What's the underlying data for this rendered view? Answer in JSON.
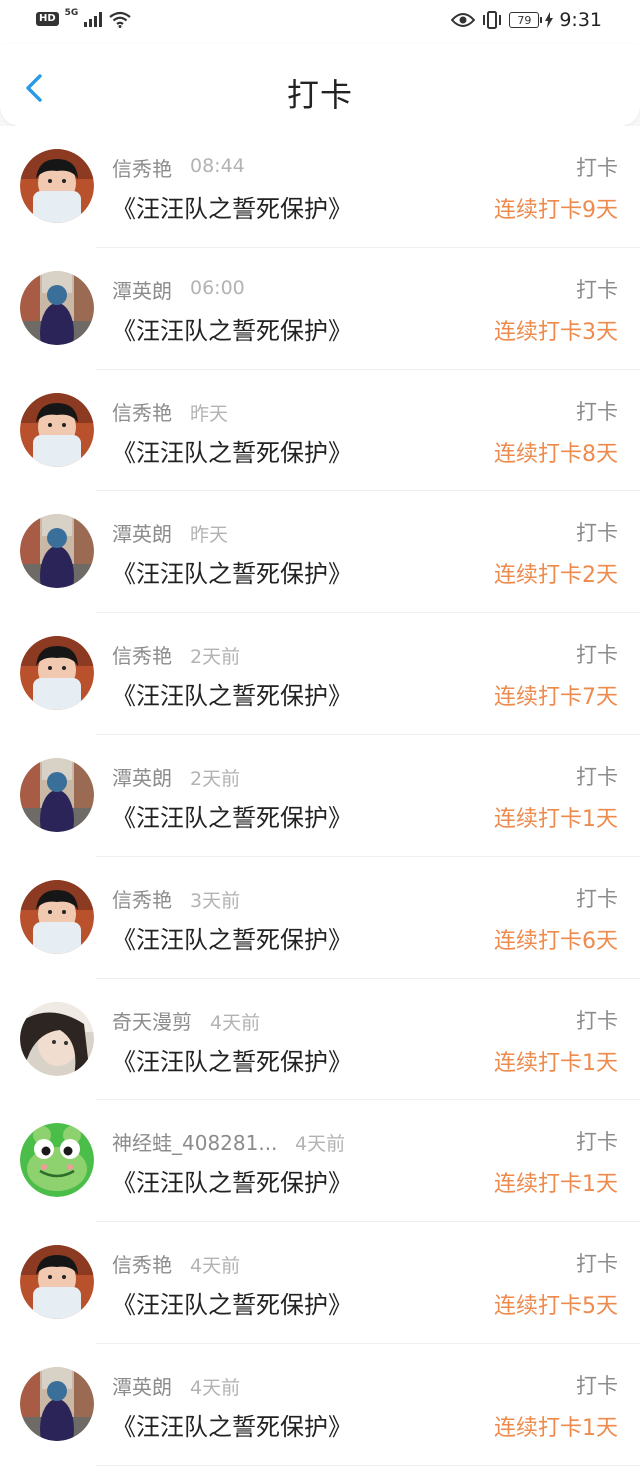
{
  "status_bar": {
    "hd_badge": "HD",
    "network": "5G",
    "battery": "79",
    "time": "9:31",
    "icons": [
      "signal-icon",
      "wifi-icon",
      "eye-icon",
      "vibrate-icon",
      "battery-icon",
      "charging-icon"
    ]
  },
  "header": {
    "title": "打卡",
    "back_icon": "chevron-left-icon",
    "accent_color": "#2a9ae8"
  },
  "colors": {
    "streak": "#ee8a4c",
    "muted": "#8c8c8c"
  },
  "rows": [
    {
      "name": "信秀艳",
      "time": "08:44",
      "title": "《汪汪队之誓死保护》",
      "action": "打卡",
      "streak": "连续打卡9天",
      "avatar": "avatar-boy"
    },
    {
      "name": "潭英朗",
      "time": "06:00",
      "title": "《汪汪队之誓死保护》",
      "action": "打卡",
      "streak": "连续打卡3天",
      "avatar": "avatar-street"
    },
    {
      "name": "信秀艳",
      "time": "昨天",
      "title": "《汪汪队之誓死保护》",
      "action": "打卡",
      "streak": "连续打卡8天",
      "avatar": "avatar-boy"
    },
    {
      "name": "潭英朗",
      "time": "昨天",
      "title": "《汪汪队之誓死保护》",
      "action": "打卡",
      "streak": "连续打卡2天",
      "avatar": "avatar-street"
    },
    {
      "name": "信秀艳",
      "time": "2天前",
      "title": "《汪汪队之誓死保护》",
      "action": "打卡",
      "streak": "连续打卡7天",
      "avatar": "avatar-boy"
    },
    {
      "name": "潭英朗",
      "time": "2天前",
      "title": "《汪汪队之誓死保护》",
      "action": "打卡",
      "streak": "连续打卡1天",
      "avatar": "avatar-street"
    },
    {
      "name": "信秀艳",
      "time": "3天前",
      "title": "《汪汪队之誓死保护》",
      "action": "打卡",
      "streak": "连续打卡6天",
      "avatar": "avatar-boy"
    },
    {
      "name": "奇天漫剪",
      "time": "4天前",
      "title": "《汪汪队之誓死保护》",
      "action": "打卡",
      "streak": "连续打卡1天",
      "avatar": "avatar-girl"
    },
    {
      "name": "神经蛙_408281...",
      "time": "4天前",
      "title": "《汪汪队之誓死保护》",
      "action": "打卡",
      "streak": "连续打卡1天",
      "avatar": "avatar-frog"
    },
    {
      "name": "信秀艳",
      "time": "4天前",
      "title": "《汪汪队之誓死保护》",
      "action": "打卡",
      "streak": "连续打卡5天",
      "avatar": "avatar-boy"
    },
    {
      "name": "潭英朗",
      "time": "4天前",
      "title": "《汪汪队之誓死保护》",
      "action": "打卡",
      "streak": "连续打卡1天",
      "avatar": "avatar-street"
    }
  ]
}
